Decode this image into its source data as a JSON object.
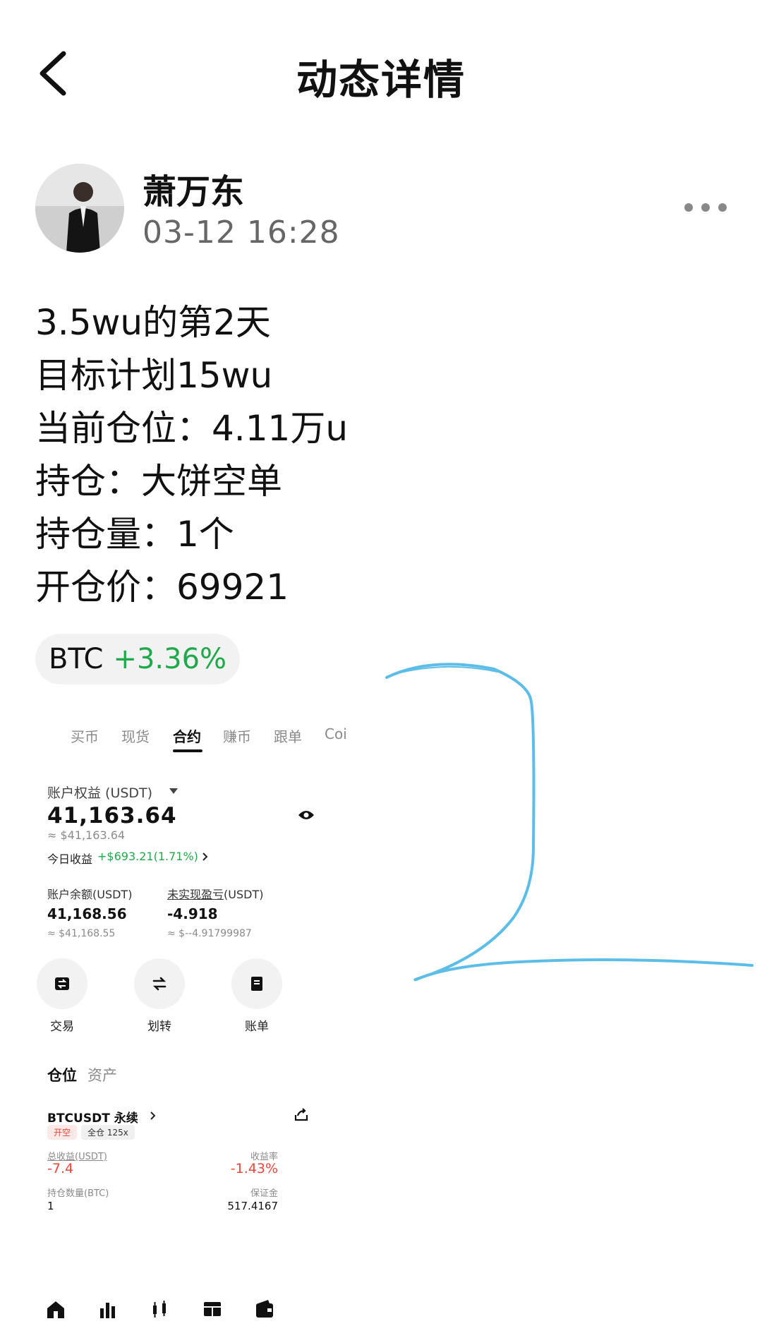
{
  "header": {
    "title": "动态详情",
    "back_icon": "chevron-left-icon"
  },
  "author": {
    "name": "萧万东",
    "time": "03-12 16:28",
    "more_icon": "more-dots-icon"
  },
  "post": {
    "lines": [
      "3.5wu的第2天",
      "目标计划15wu",
      "当前仓位：4.11万u",
      "持仓：大饼空单",
      "持仓量：1个",
      "开仓价：69921"
    ]
  },
  "ticker": {
    "symbol": "BTC",
    "change": "+3.36%",
    "change_color": "#1fa94a"
  },
  "screenshot": {
    "tabs": [
      "买币",
      "现货",
      "合约",
      "赚币",
      "跟单",
      "Coi"
    ],
    "active_tab": "合约",
    "equity_label": "账户权益 (USDT)",
    "equity_value": "41,163.64",
    "equity_usd": "≈ $41,163.64",
    "today_label": "今日收益",
    "today_value": "+$693.21(1.71%)",
    "balance_label": "账户余额(USDT)",
    "balance_value": "41,168.56",
    "balance_usd": "≈ $41,168.55",
    "unrealized_label_u": "未实现盈亏",
    "unrealized_label_suffix": "(USDT)",
    "unrealized_value": "-4.918",
    "unrealized_usd": "≈ $--4.91799987",
    "actions": [
      {
        "label": "交易",
        "icon": "trade-icon"
      },
      {
        "label": "划转",
        "icon": "transfer-icon"
      },
      {
        "label": "账单",
        "icon": "bill-icon"
      }
    ],
    "section_tabs": [
      "仓位",
      "资产"
    ],
    "position": {
      "symbol": "BTCUSDT 永续",
      "side_tag": "开空",
      "margin_tag": "全仓 125x",
      "pnl_label": "总收益(USDT)",
      "pnl_value": "-7.4",
      "roi_label": "收益率",
      "roi_value": "-1.43%",
      "qty_label": "持仓数量(BTC)",
      "qty_value": "1",
      "margin_label": "保证金",
      "margin_value": "517.4167"
    },
    "bottom_nav_icons": [
      "home-icon",
      "market-icon",
      "trade-candles-icon",
      "grid-icon",
      "wallet-icon"
    ]
  },
  "colors": {
    "positive": "#1fa94a",
    "negative": "#f0463a",
    "annotation": "#5bbde8"
  }
}
